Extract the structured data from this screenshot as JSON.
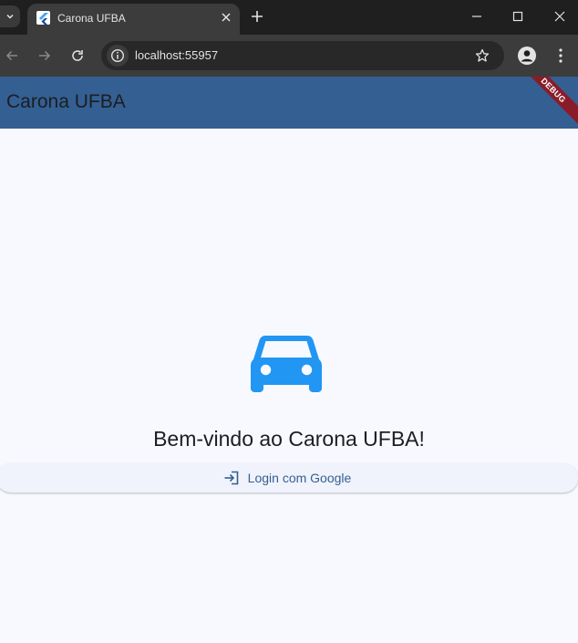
{
  "browser": {
    "tab_title": "Carona UFBA",
    "url": "localhost:55957"
  },
  "app": {
    "title": "Carona UFBA",
    "debug_banner": "DEBUG",
    "welcome_text": "Bem-vindo ao Carona UFBA!",
    "login_button_label": "Login com Google"
  },
  "colors": {
    "app_bar": "#345f92",
    "car_icon": "#2196f3",
    "background": "#f8f9ff",
    "debug_banner": "#8a1c2a"
  },
  "icons": {
    "hero": "car-icon",
    "login": "login-icon"
  }
}
